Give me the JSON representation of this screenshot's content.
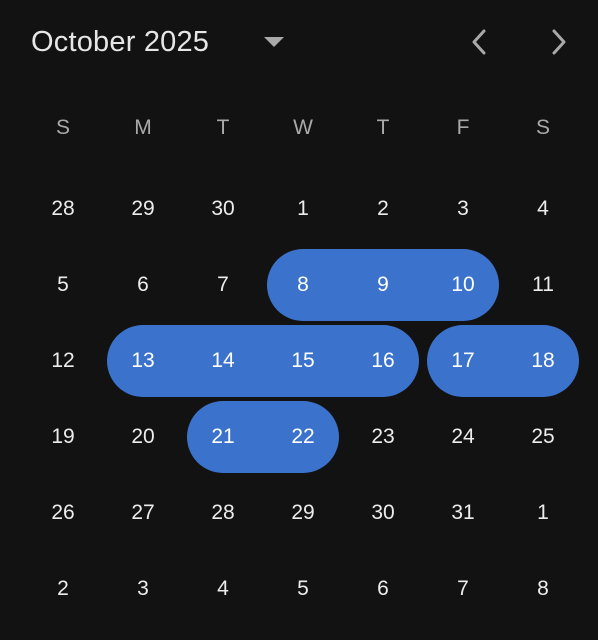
{
  "header": {
    "month_year": "October 2025",
    "dropdown_icon": "caret-down-icon",
    "prev_icon": "chevron-left-icon",
    "next_icon": "chevron-right-icon"
  },
  "weekdays": [
    "S",
    "M",
    "T",
    "W",
    "T",
    "F",
    "S"
  ],
  "weeks": [
    [
      "28",
      "29",
      "30",
      "1",
      "2",
      "3",
      "4"
    ],
    [
      "5",
      "6",
      "7",
      "8",
      "9",
      "10",
      "11"
    ],
    [
      "12",
      "13",
      "14",
      "15",
      "16",
      "17",
      "18"
    ],
    [
      "19",
      "20",
      "21",
      "22",
      "23",
      "24",
      "25"
    ],
    [
      "26",
      "27",
      "28",
      "29",
      "30",
      "31",
      "1"
    ],
    [
      "2",
      "3",
      "4",
      "5",
      "6",
      "7",
      "8"
    ]
  ],
  "selected_ranges": [
    {
      "week": 1,
      "from_col": 3,
      "to_col": 5
    },
    {
      "week": 2,
      "from_col": 1,
      "to_col": 4
    },
    {
      "week": 2,
      "from_col": 5,
      "to_col": 6
    },
    {
      "week": 3,
      "from_col": 2,
      "to_col": 3
    }
  ],
  "colors": {
    "background": "#121212",
    "selection": "#3b73cc",
    "text": "#ececec",
    "weekday_text": "#a9a9a9"
  }
}
